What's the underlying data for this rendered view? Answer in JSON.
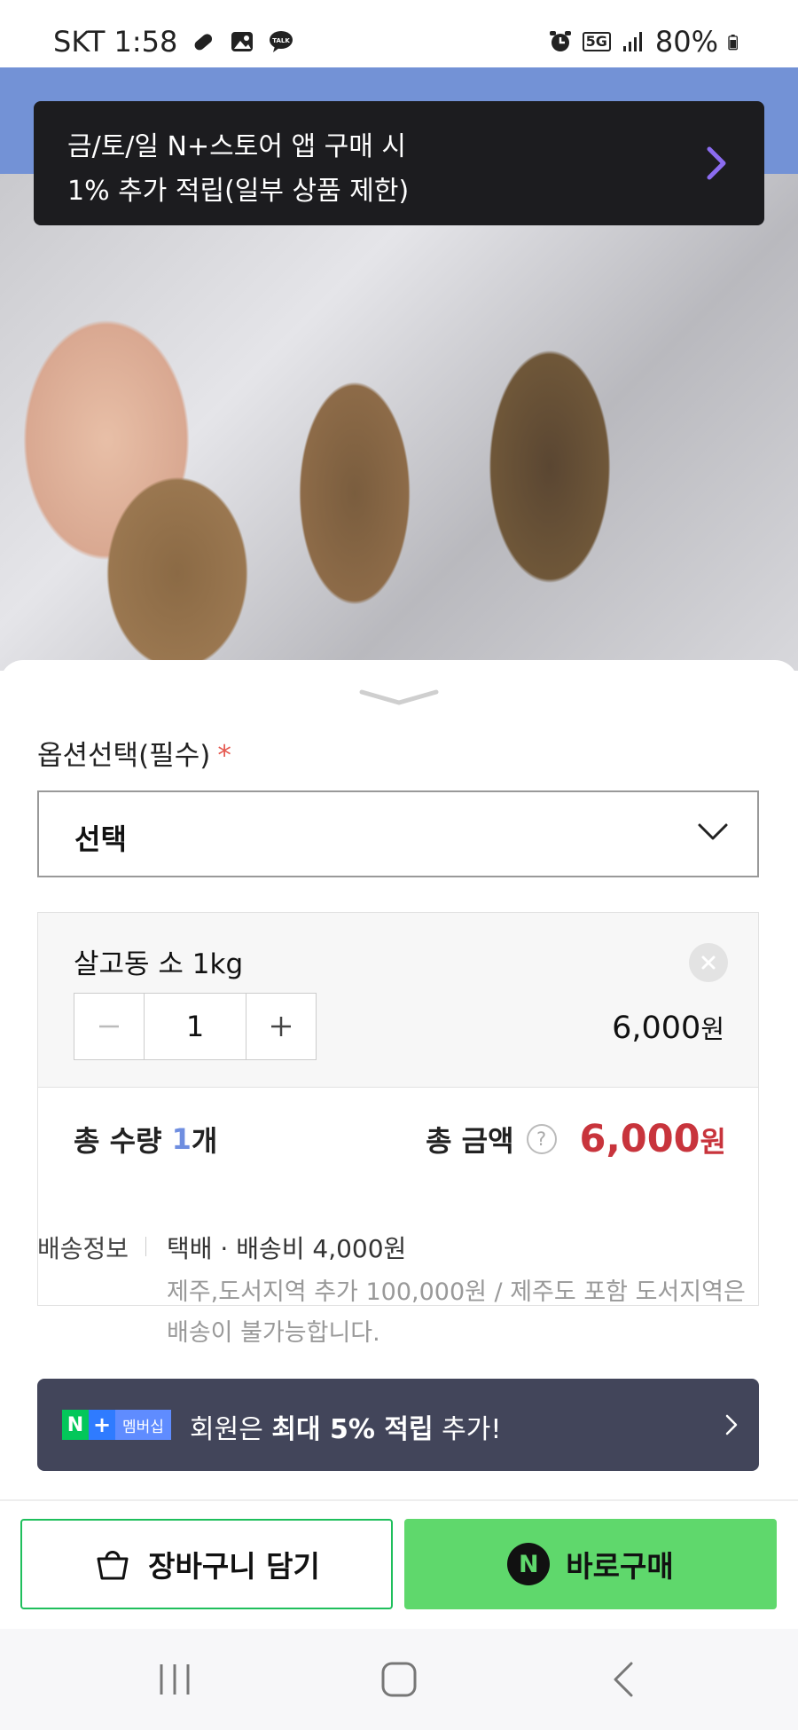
{
  "status_bar": {
    "carrier_time": "SKT 1:58",
    "network": "5G",
    "battery": "80%"
  },
  "promo_banner": {
    "line1": "금/토/일 N+스토어 앱 구매 시",
    "line2": "1% 추가 적립(일부 상품 제한)"
  },
  "option_sheet": {
    "label": "옵션선택(필수)",
    "required_mark": "*",
    "select_value": "선택",
    "selected_item": {
      "name": "살고동 소 1kg",
      "quantity": "1",
      "price": "6,000",
      "price_unit": "원"
    },
    "totals": {
      "qty_label": "총 수량",
      "qty_value": "1",
      "qty_unit": "개",
      "amount_label": "총 금액",
      "amount_value": "6,000",
      "amount_unit": "원"
    }
  },
  "shipping": {
    "label": "배송정보",
    "main": "택배 · 배송비 4,000원",
    "note": "제주,도서지역 추가 100,000원 / 제주도 포함 도서지역은 배송이 불가능합니다."
  },
  "membership": {
    "badge_n": "N",
    "badge_plus": "+",
    "badge_text": "멤버십",
    "text_pre": "회원은 ",
    "text_bold": "최대 5% 적립",
    "text_post": " 추가!"
  },
  "actions": {
    "cart_label": "장바구니 담기",
    "buy_icon_text": "N",
    "buy_label": "바로구매"
  },
  "colors": {
    "accent_green": "#5fd86c",
    "price_red": "#c8343c",
    "promo_bg": "#1c1c1f",
    "membership_bg": "#42455a",
    "qty_blue": "#6f8ee0"
  }
}
